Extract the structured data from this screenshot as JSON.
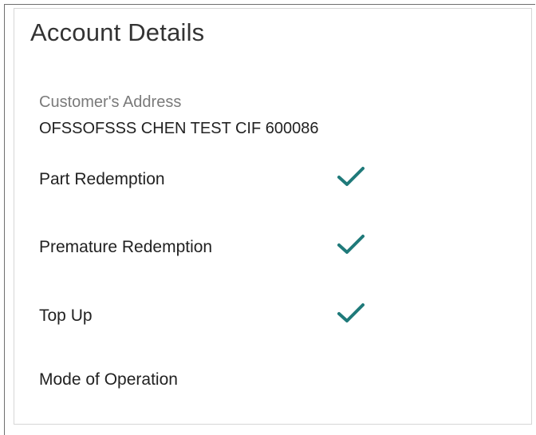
{
  "panel": {
    "title": "Account Details",
    "customer_address_label": "Customer's Address",
    "customer_address_value": "OFSSOFSSS CHEN TEST CIF 600086",
    "rows": [
      {
        "label": "Part Redemption",
        "checked": true
      },
      {
        "label": "Premature Redemption",
        "checked": true
      },
      {
        "label": "Top Up",
        "checked": true
      },
      {
        "label": "Mode of Operation"
      }
    ]
  },
  "colors": {
    "check": "#1f7a7a",
    "muted_label": "#7a7a7a",
    "text": "#222222"
  },
  "icons": {
    "checkmark": "checkmark-icon"
  }
}
